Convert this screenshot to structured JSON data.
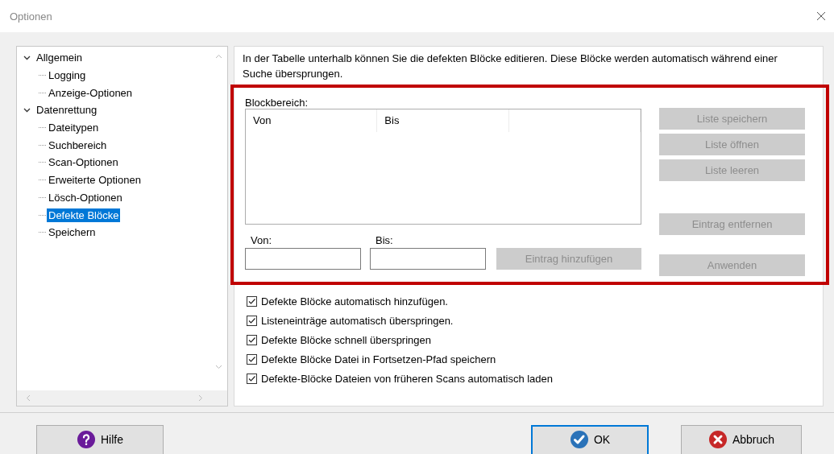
{
  "window": {
    "title": "Optionen"
  },
  "tree": {
    "items": [
      {
        "label": "Allgemein",
        "expanded": true,
        "selected": false,
        "children": [
          {
            "label": "Logging",
            "selected": false
          },
          {
            "label": "Anzeige-Optionen",
            "selected": false
          }
        ]
      },
      {
        "label": "Datenrettung",
        "expanded": true,
        "selected": false,
        "children": [
          {
            "label": "Dateitypen",
            "selected": false
          },
          {
            "label": "Suchbereich",
            "selected": false
          },
          {
            "label": "Scan-Optionen",
            "selected": false
          },
          {
            "label": "Erweiterte Optionen",
            "selected": false
          },
          {
            "label": "Lösch-Optionen",
            "selected": false
          },
          {
            "label": "Defekte Blöcke",
            "selected": true
          },
          {
            "label": "Speichern",
            "selected": false
          }
        ]
      }
    ]
  },
  "panel": {
    "description": "In der Tabelle unterhalb können Sie die defekten Blöcke editieren. Diese Blöcke werden automatisch während einer Suche übersprungen.",
    "highlighted": true,
    "block_range": {
      "label": "Blockbereich:",
      "columns": [
        "Von",
        "Bis"
      ]
    },
    "fields": [
      {
        "label": "Von:"
      },
      {
        "label": "Bis:"
      }
    ],
    "add_button": {
      "label": "Eintrag hinzufügen",
      "disabled": true
    },
    "list_buttons": [
      {
        "label": "Liste speichern",
        "disabled": true
      },
      {
        "label": "Liste öffnen",
        "disabled": true
      },
      {
        "label": "Liste leeren",
        "disabled": true
      }
    ],
    "remove_button": {
      "label": "Eintrag entfernen",
      "disabled": true
    },
    "apply_button": {
      "label": "Anwenden",
      "disabled": true
    },
    "checkboxes": [
      {
        "label": "Defekte Blöcke automatisch hinzufügen.",
        "checked": true
      },
      {
        "label": "Listeneinträge automatisch überspringen.",
        "checked": true
      },
      {
        "label": "Defekte Blöcke schnell überspringen",
        "checked": true
      },
      {
        "label": "Defekte Blöcke Datei in Fortsetzen-Pfad speichern",
        "checked": true
      },
      {
        "label": "Defekte-Blöcke Dateien von früheren Scans automatisch laden",
        "checked": true
      }
    ]
  },
  "footer": {
    "buttons": [
      {
        "label": "Hilfe",
        "kind": "help",
        "default": false
      },
      {
        "label": "OK",
        "kind": "ok",
        "default": true
      },
      {
        "label": "Abbruch",
        "kind": "cancel",
        "default": false
      }
    ]
  }
}
